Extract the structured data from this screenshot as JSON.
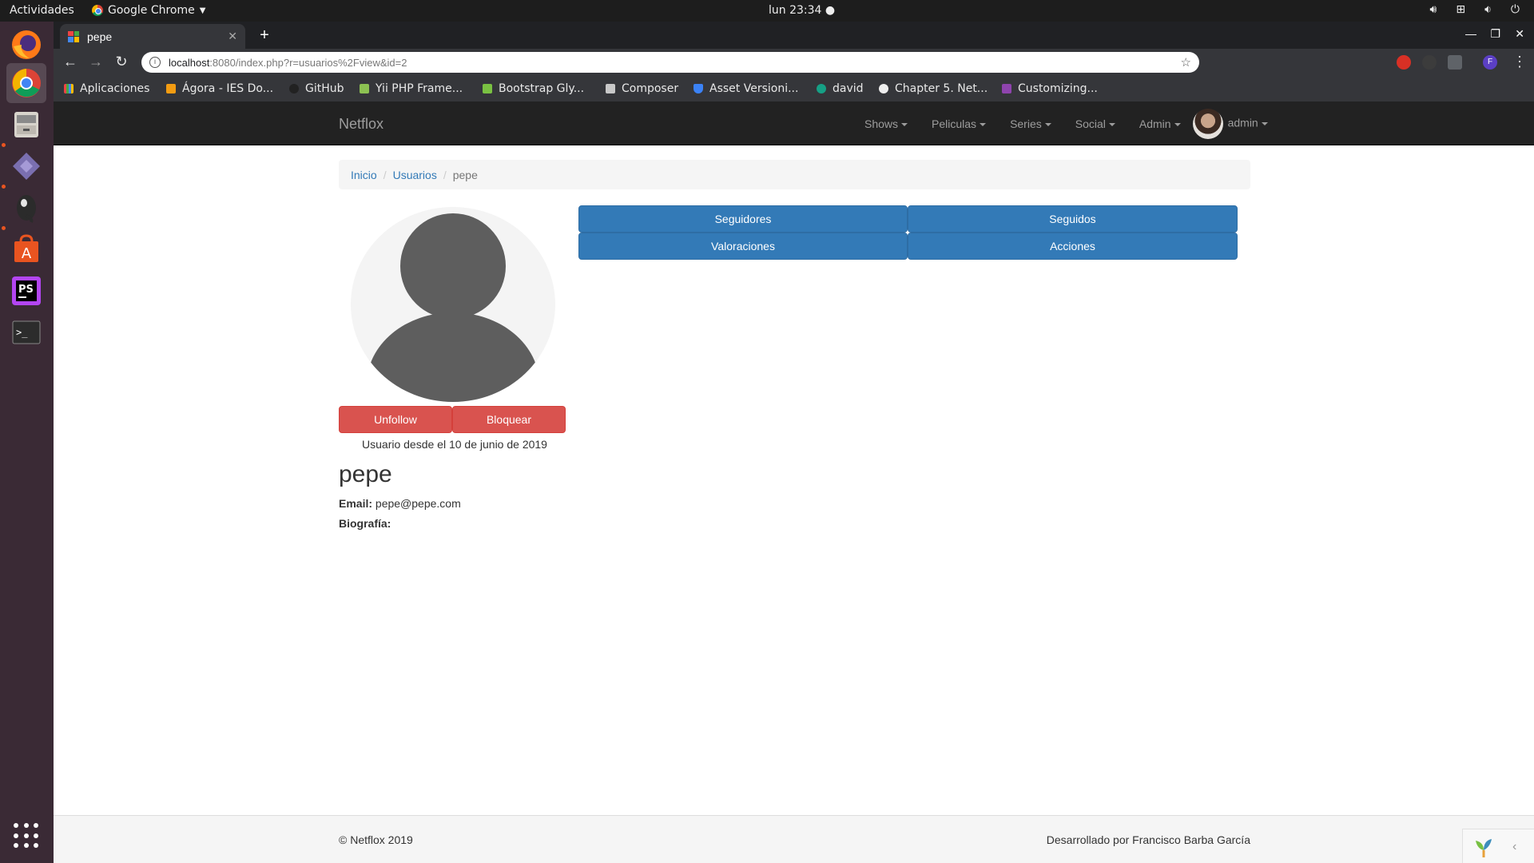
{
  "os": {
    "activities": "Actividades",
    "app_menu": "Google Chrome",
    "clock": "lun 23:34 ●"
  },
  "browser": {
    "tab_title": "pepe",
    "url_host": "localhost",
    "url_rest": ":8080/index.php?r=usuarios%2Fview&id=2",
    "profile_initial": "F",
    "bookmarks": [
      {
        "label": "Aplicaciones",
        "icon": "apps-grid-icon"
      },
      {
        "label": "Ágora - IES Do...",
        "icon": "agora-icon"
      },
      {
        "label": "GitHub",
        "icon": "github-icon"
      },
      {
        "label": "Yii PHP Frame...",
        "icon": "yii-icon"
      },
      {
        "label": "Bootstrap Gly...",
        "icon": "bootstrap-icon"
      },
      {
        "label": "Composer",
        "icon": "folder-icon"
      },
      {
        "label": "Asset Versioni...",
        "icon": "shield-icon"
      },
      {
        "label": "david",
        "icon": "user-icon"
      },
      {
        "label": "Chapter 5. Net...",
        "icon": "globe-icon"
      },
      {
        "label": "Customizing...",
        "icon": "h-icon"
      }
    ]
  },
  "nav": {
    "brand": "Netflox",
    "items": [
      "Shows",
      "Peliculas",
      "Series",
      "Social",
      "Admin"
    ],
    "user": "admin"
  },
  "breadcrumb": {
    "home": "Inicio",
    "section": "Usuarios",
    "current": "pepe"
  },
  "profile": {
    "unfollow": "Unfollow",
    "block": "Bloquear",
    "member_since": "Usuario desde el 10 de junio de 2019",
    "username": "pepe",
    "email_label": "Email:",
    "email": "pepe@pepe.com",
    "bio_label": "Biografía:",
    "bio": ""
  },
  "actions": {
    "followers": "Seguidores",
    "following": "Seguidos",
    "ratings": "Valoraciones",
    "activity": "Acciones"
  },
  "footer": {
    "copyright": "© Netflox 2019",
    "credits": "Desarrollado por Francisco Barba García"
  },
  "colors": {
    "primary": "#337ab7",
    "danger": "#d9534f",
    "navbar": "#222222",
    "dock": "#3a2a35"
  }
}
